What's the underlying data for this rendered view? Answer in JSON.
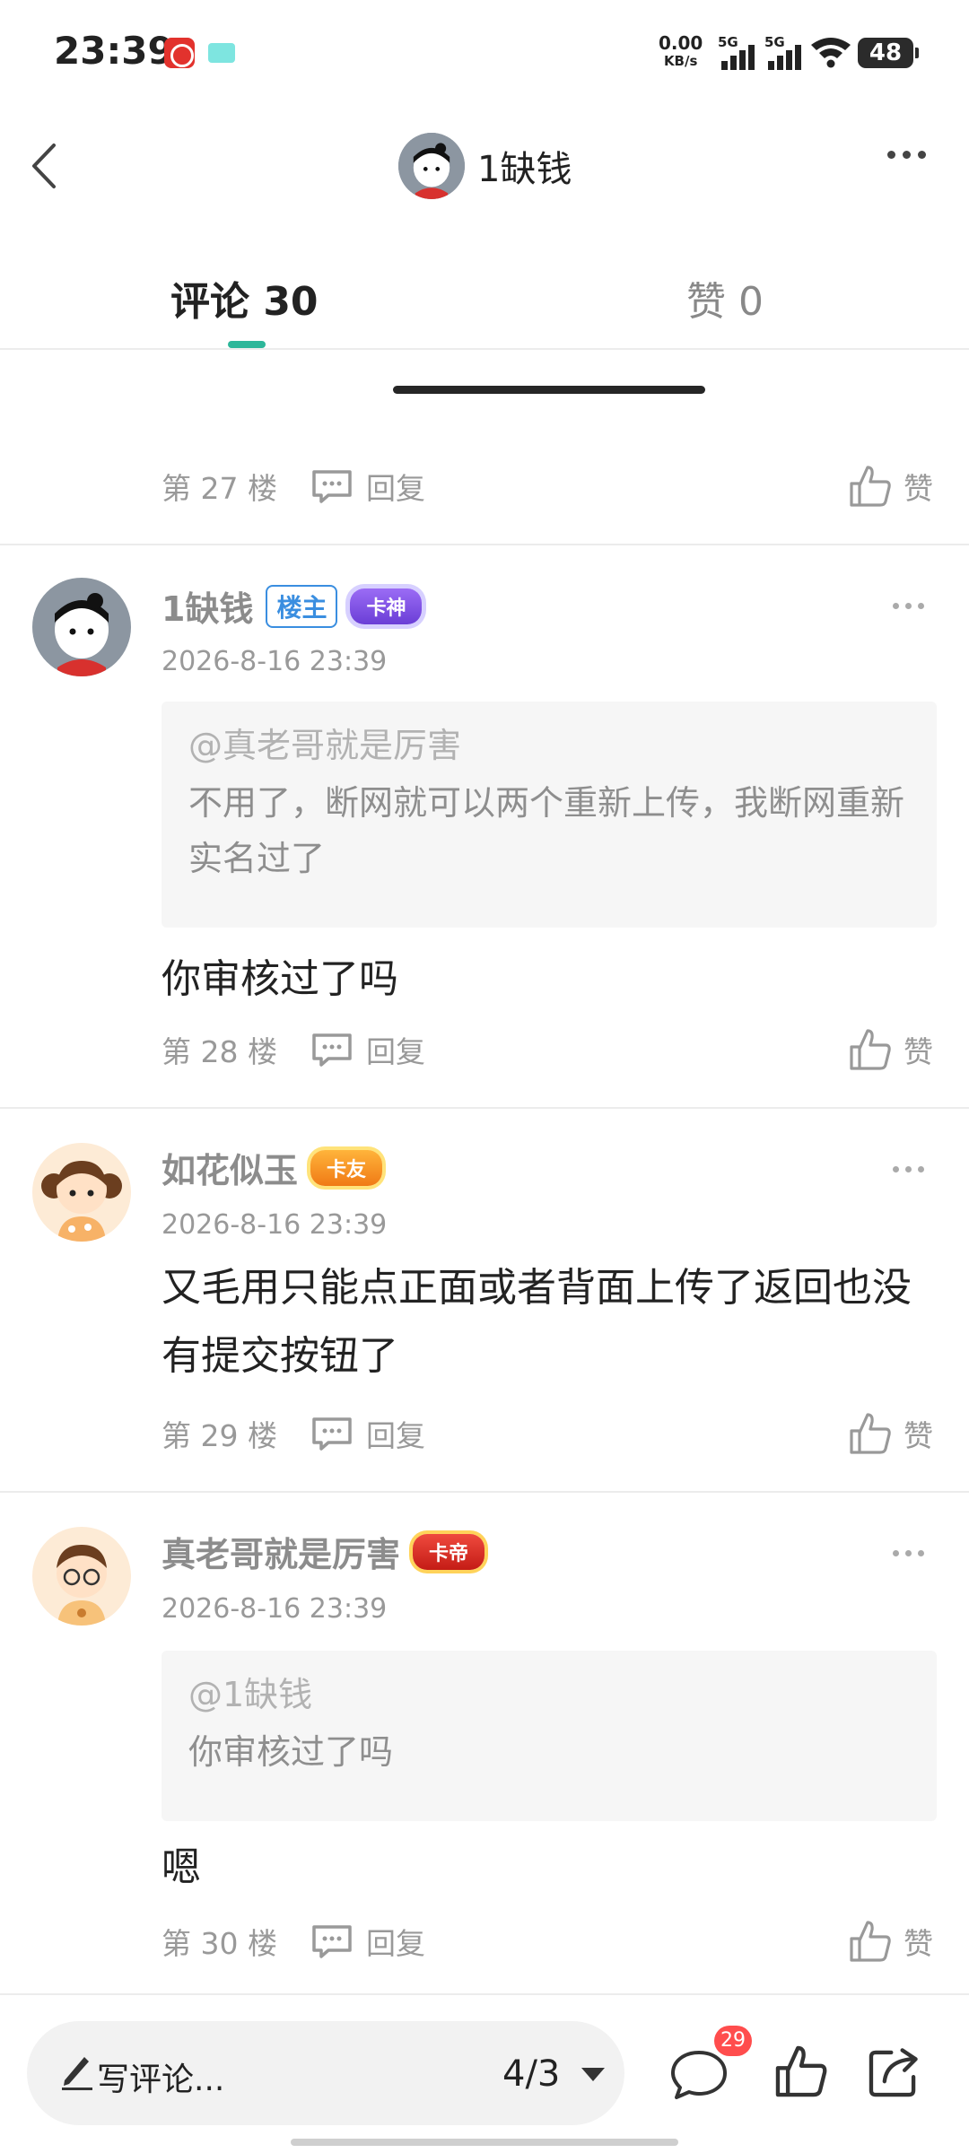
{
  "status_bar": {
    "time": "23:39",
    "net_speed": "0.00",
    "net_unit": "KB/s",
    "sim1": "5G",
    "sim2": "5G",
    "battery": "48"
  },
  "header": {
    "username": "1缺钱"
  },
  "tabs": [
    {
      "label": "评论 30",
      "active": true
    },
    {
      "label": "赞 0",
      "active": false
    }
  ],
  "labels": {
    "reply": "回复",
    "like": "赞",
    "owner_badge": "楼主"
  },
  "comments": [
    {
      "floor": "第 27 楼"
    },
    {
      "user": "1缺钱",
      "is_owner": true,
      "rank": "卡神",
      "time": "2026-8-16 23:39",
      "quote_at": "@真老哥就是厉害",
      "quote_text": "不用了，断网就可以两个重新上传，我断网重新实名过了",
      "text": "你审核过了吗",
      "floor": "第 28 楼"
    },
    {
      "user": "如花似玉",
      "rank": "卡友",
      "time": "2026-8-16 23:39",
      "text": "又毛用只能点正面或者背面上传了返回也没有提交按钮了",
      "floor": "第 29 楼"
    },
    {
      "user": "真老哥就是厉害",
      "rank": "卡帝",
      "time": "2026-8-16 23:39",
      "quote_at": "@1缺钱",
      "quote_text": "你审核过了吗",
      "text": "嗯",
      "floor": "第 30 楼"
    }
  ],
  "bottom_bar": {
    "write_label": "写评论...",
    "page_indicator": "4/3",
    "comment_count": "29"
  },
  "colors": {
    "accent": "#2db79a",
    "badge_red": "#ff4d4d",
    "owner_blue": "#3a8ee0"
  }
}
